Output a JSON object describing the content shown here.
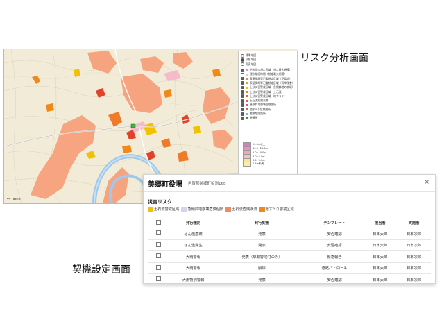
{
  "captions": {
    "risk_screen": "リスク分析画面",
    "setting_screen": "契機設定画面"
  },
  "map": {
    "scale_text": "35.00037",
    "base_layers": [
      {
        "label": "標準地図",
        "selected": false
      },
      {
        "label": "淡色地図",
        "selected": true
      },
      {
        "label": "写真地図",
        "selected": false
      }
    ],
    "overlay_layers": [
      {
        "label": "洪水浸水想定区域（想定最大規模）",
        "checked": true,
        "swatch": "#f08fb8"
      },
      {
        "label": "浸水継続時間（想定最大規模）",
        "checked": false,
        "swatch": "#b6d9f2"
      },
      {
        "label": "家屋倒壊等氾濫想定区域（氾濫流）",
        "checked": true,
        "swatch": "#e38a54"
      },
      {
        "label": "家屋倒壊等氾濫想定区域（河岸侵食）",
        "checked": true,
        "swatch": "#d7a13a"
      },
      {
        "label": "土砂災害警戒区域（急傾斜地の崩壊）",
        "checked": true,
        "swatch": "#f2c200"
      },
      {
        "label": "土砂災害警戒区域（土石流）",
        "checked": true,
        "swatch": "#ef7a2a"
      },
      {
        "label": "土砂災害警戒区域（地すべり）",
        "checked": true,
        "swatch": "#e06a2a"
      },
      {
        "label": "土石流危険渓流",
        "checked": true,
        "swatch": "#e05a5a"
      },
      {
        "label": "急傾斜地崩壊危険箇所",
        "checked": true,
        "swatch": "#c45a8a"
      },
      {
        "label": "地すべり危険箇所",
        "checked": true,
        "swatch": "#b9773f"
      },
      {
        "label": "雪崩危険箇所",
        "checked": true,
        "swatch": "#8ab0d8"
      },
      {
        "label": "避難所",
        "checked": true,
        "swatch": "#4a8a3a"
      }
    ],
    "legend": [
      {
        "label": "20.0m以上",
        "color": "#dc7ac8"
      },
      {
        "label": "10.0~20.0m",
        "color": "#f08fc0"
      },
      {
        "label": "5.0~10.0m",
        "color": "#f5a6b8"
      },
      {
        "label": "3.0~5.0m",
        "color": "#fbc0b6"
      },
      {
        "label": "0.5~3.0m",
        "color": "#fbe0a8"
      },
      {
        "label": "0.5m未満",
        "color": "#f7f0a0"
      }
    ]
  },
  "dialog": {
    "title": "美郷町役場",
    "address": "邑智郡美郷町粕渕168",
    "close_icon": "×",
    "risk_heading": "災害リスク",
    "risk_tags": [
      {
        "label": "土石流警戒区域",
        "color": "#f2c200"
      },
      {
        "label": "急傾斜地崩壊危険個所",
        "color": "#d6d3ea"
      },
      {
        "label": "土石流危険渓流",
        "color": "#f08a60"
      },
      {
        "label": "地すべり警戒区域",
        "color": "#ef8a1a"
      }
    ],
    "columns": [
      "発行種別",
      "発行契機",
      "テンプレート",
      "担当者",
      "実施者"
    ],
    "rows": [
      [
        "はん濫危険",
        "発表",
        "安否確認",
        "日本太郎",
        "日本次郎"
      ],
      [
        "はん濫発生",
        "発表",
        "安否確認",
        "日本太郎",
        "日本次郎"
      ],
      [
        "大雨警報",
        "発表（早期警戒付のみ）",
        "緊急報告",
        "日本太郎",
        "日本次郎"
      ],
      [
        "大雨警報",
        "解除",
        "道路パトロール",
        "日本太郎",
        "日本次郎"
      ],
      [
        "大雨特別警報",
        "発表",
        "安否確認",
        "日本太郎",
        "日本次郎"
      ]
    ]
  }
}
